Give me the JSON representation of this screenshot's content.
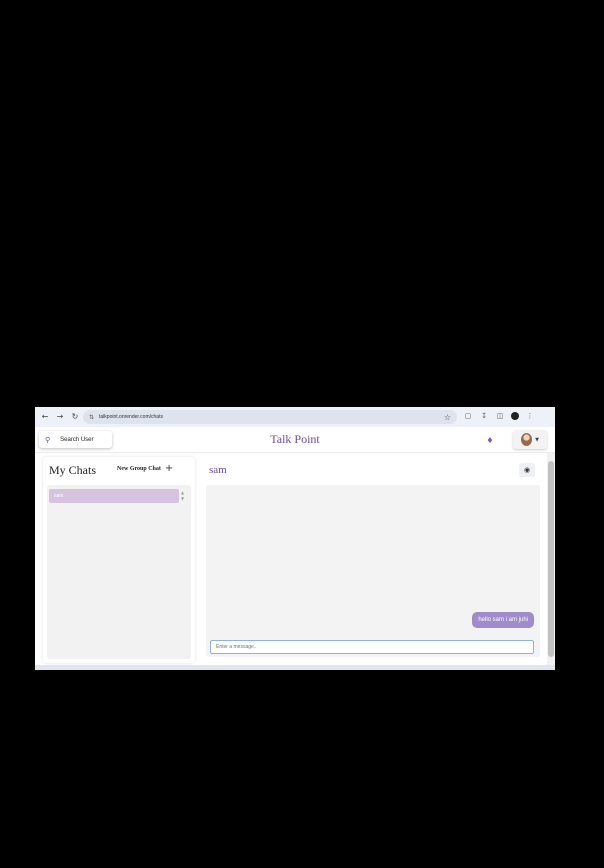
{
  "browser": {
    "url": "talkpoint.onrender.com/chats",
    "icons": [
      "back-icon",
      "forward-icon",
      "reload-icon",
      "tune-icon",
      "star-icon",
      "extension-icon",
      "download-icon",
      "menu-icon"
    ]
  },
  "header": {
    "search_label": "Search User",
    "title": "Talk Point"
  },
  "chats": {
    "title": "My Chats",
    "new_group_label": "New Group Chat",
    "items": [
      {
        "label": "sam"
      }
    ]
  },
  "conversation": {
    "name": "sam",
    "messages": [
      {
        "text": "hello sam i am juhi",
        "from": "me"
      }
    ],
    "input_placeholder": "Enter a message.."
  },
  "colors": {
    "brand": "#6b4f93",
    "selected_chat": "#d6c3dd",
    "my_bubble": "#9f8ccb"
  }
}
